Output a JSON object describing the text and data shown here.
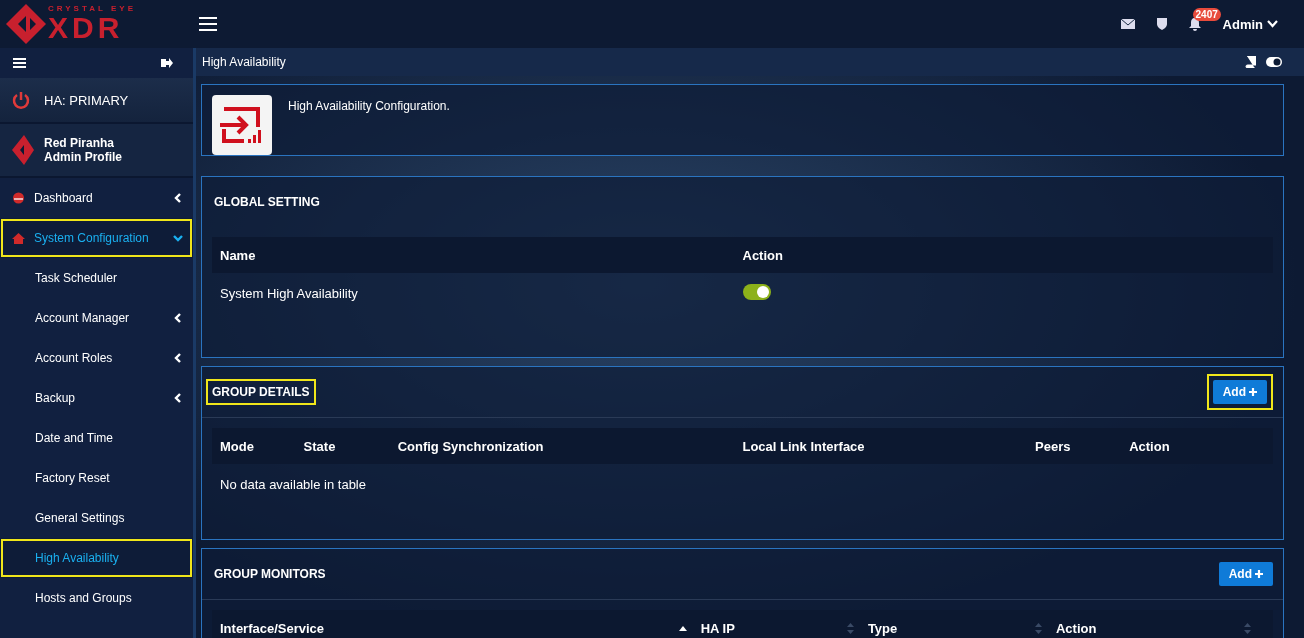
{
  "header": {
    "logo_small": "CRYSTAL EYE",
    "logo_big": "XDR",
    "notifications": "2407",
    "user": "Admin"
  },
  "sidebar": {
    "ha_status": "HA: PRIMARY",
    "profile_name": "Red Piranha",
    "profile_role": "Admin Profile",
    "items": [
      {
        "label": "Dashboard",
        "kind": "top",
        "selected": false,
        "has_children": true,
        "expanded": false,
        "highlighted": false
      },
      {
        "label": "System Configuration",
        "kind": "top",
        "selected": true,
        "has_children": true,
        "expanded": true,
        "highlighted": true
      },
      {
        "label": "Task Scheduler",
        "kind": "sub",
        "selected": false,
        "has_children": false,
        "expanded": false,
        "highlighted": false
      },
      {
        "label": "Account Manager",
        "kind": "sub",
        "selected": false,
        "has_children": true,
        "expanded": false,
        "highlighted": false
      },
      {
        "label": "Account Roles",
        "kind": "sub",
        "selected": false,
        "has_children": true,
        "expanded": false,
        "highlighted": false
      },
      {
        "label": "Backup",
        "kind": "sub",
        "selected": false,
        "has_children": true,
        "expanded": false,
        "highlighted": false
      },
      {
        "label": "Date and Time",
        "kind": "sub",
        "selected": false,
        "has_children": false,
        "expanded": false,
        "highlighted": false
      },
      {
        "label": "Factory Reset",
        "kind": "sub",
        "selected": false,
        "has_children": false,
        "expanded": false,
        "highlighted": false
      },
      {
        "label": "General Settings",
        "kind": "sub",
        "selected": false,
        "has_children": false,
        "expanded": false,
        "highlighted": false
      },
      {
        "label": "High Availability",
        "kind": "sub",
        "selected": true,
        "has_children": false,
        "expanded": false,
        "highlighted": true
      },
      {
        "label": "Hosts and Groups",
        "kind": "sub",
        "selected": false,
        "has_children": false,
        "expanded": false,
        "highlighted": false
      }
    ]
  },
  "page_title": "High Availability",
  "intro": "High Availability Configuration.",
  "global_setting": {
    "title": "GLOBAL SETTING",
    "columns": [
      "Name",
      "Action"
    ],
    "rows": [
      {
        "name": "System High Availability",
        "on": true
      }
    ]
  },
  "group_details": {
    "title": "GROUP DETAILS",
    "title_highlighted": true,
    "add": "Add",
    "add_highlighted": true,
    "columns": [
      "Mode",
      "State",
      "Config Synchronization",
      "Local Link Interface",
      "Peers",
      "Action"
    ],
    "empty": "No data available in table"
  },
  "group_monitors": {
    "title": "GROUP MONITORS",
    "add": "Add",
    "columns": [
      "Interface/Service",
      "HA IP",
      "Type",
      "Action"
    ]
  }
}
